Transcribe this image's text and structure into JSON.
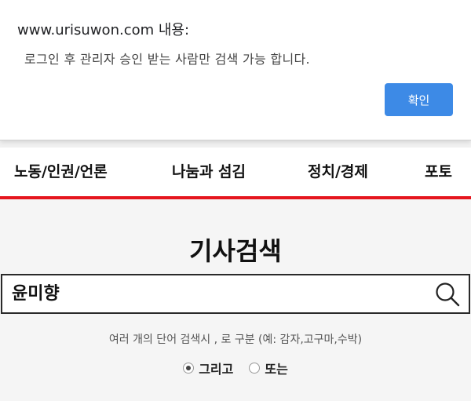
{
  "dialog": {
    "title": "www.urisuwon.com 내용:",
    "message": "로그인 후 관리자 승인 받는 사람만  검색 가능 합니다.",
    "ok_label": "확인"
  },
  "nav": {
    "items": [
      "노동/인권/언론",
      "나눔과 섬김",
      "정치/경제",
      "포토"
    ]
  },
  "search": {
    "heading": "기사검색",
    "query": "윤미향",
    "hint": "여러 개의 단어 검색시 , 로 구분 (예: 감자,고구마,수박)",
    "options": [
      {
        "label": "그리고",
        "checked": true
      },
      {
        "label": "또는",
        "checked": false
      }
    ]
  },
  "colors": {
    "accent_red": "#e5161e",
    "button_blue": "#3d8ae6"
  }
}
